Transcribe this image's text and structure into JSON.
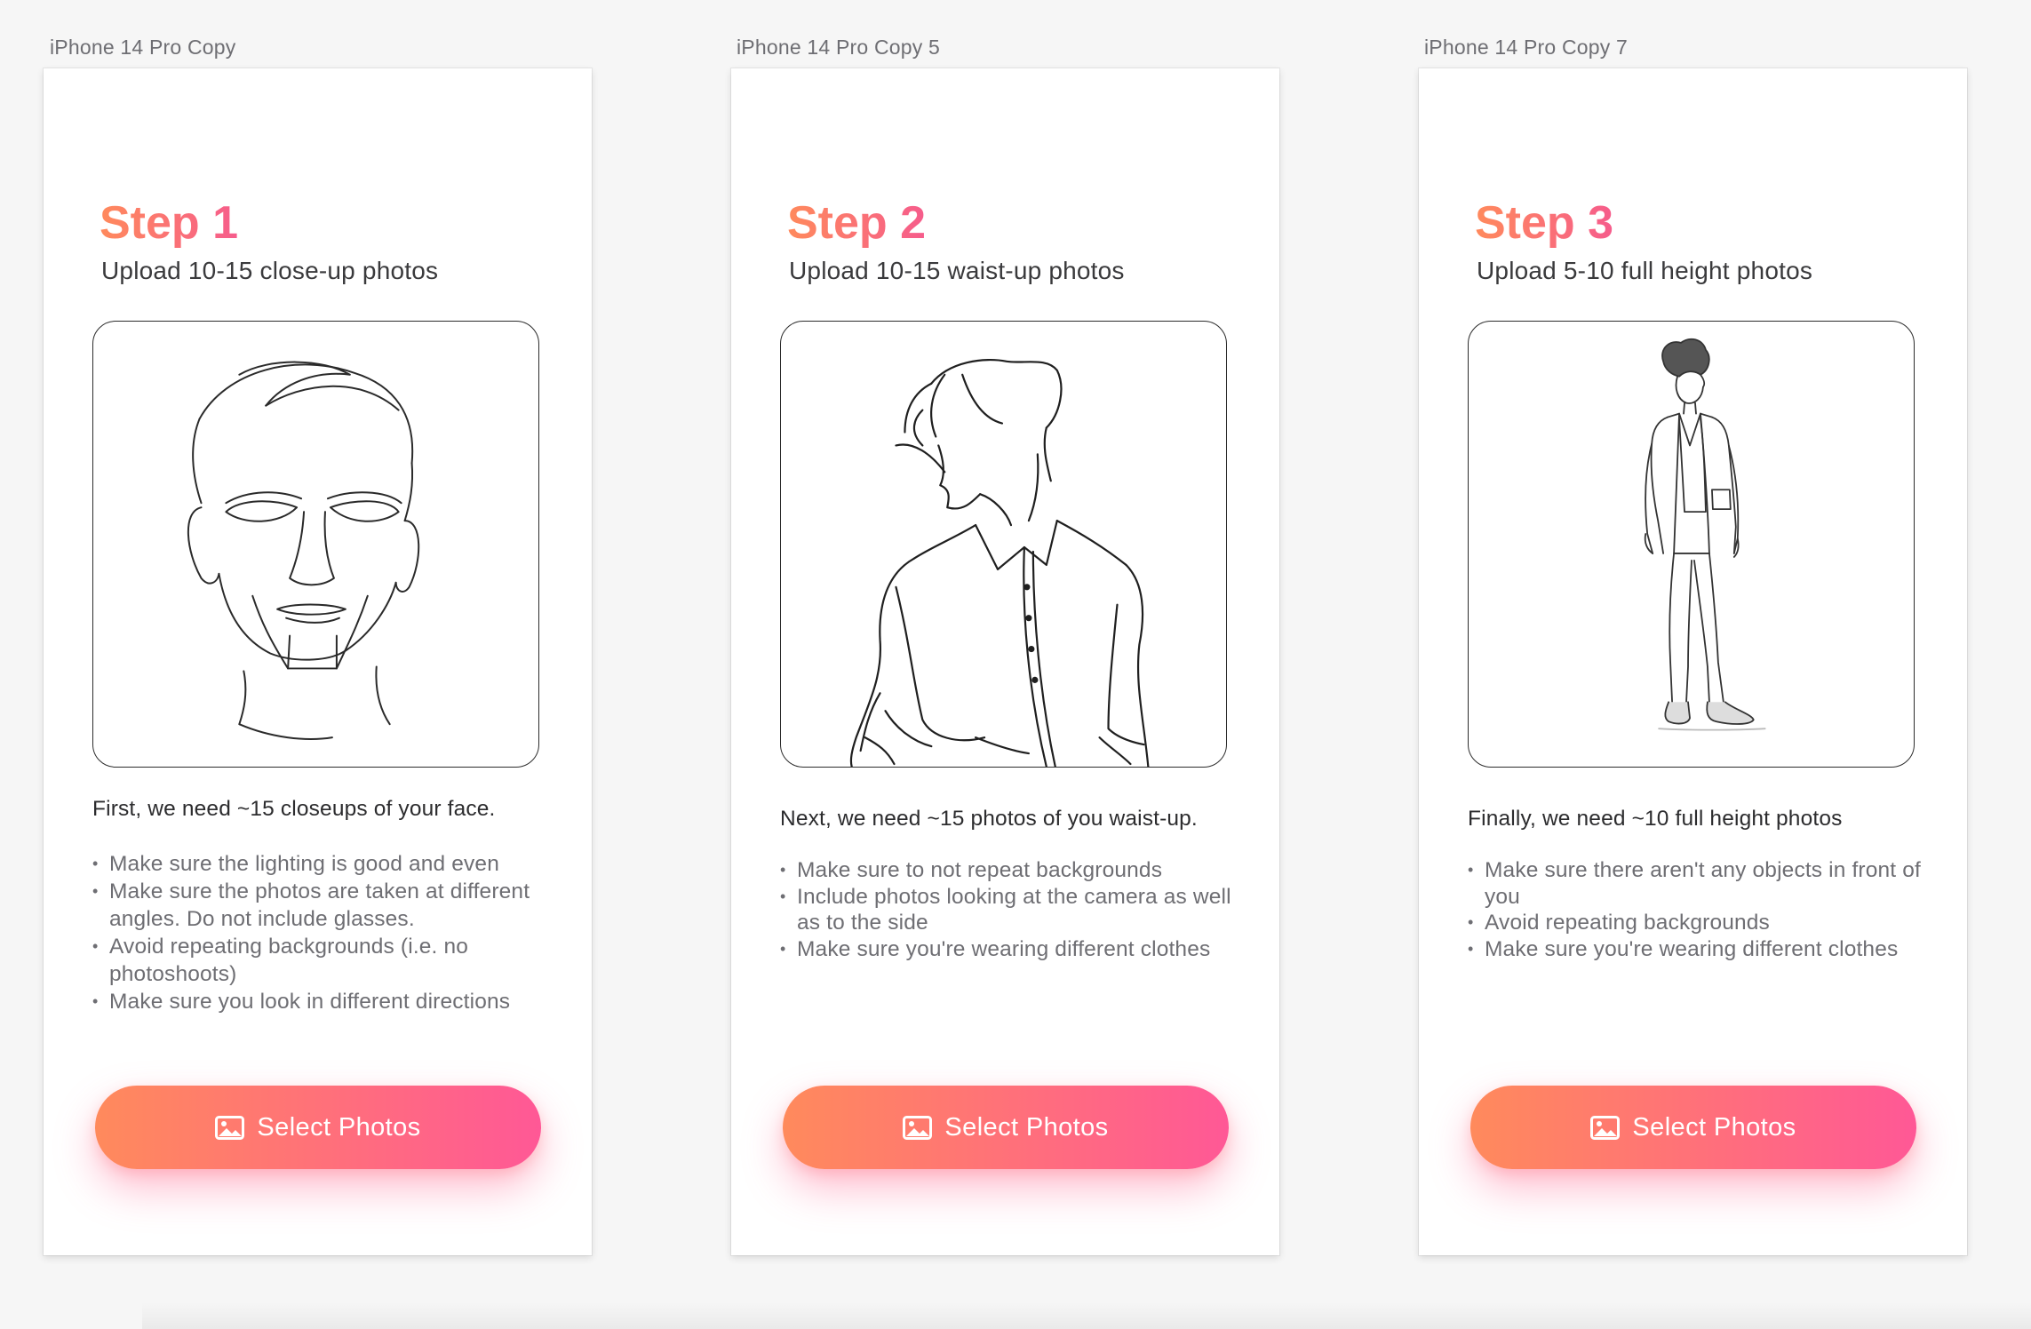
{
  "artboards": [
    {
      "label": "iPhone 14 Pro Copy",
      "step_title": "Step 1",
      "subtitle": "Upload 10-15 close-up photos",
      "illustration_icon": "face-closeup-line-art",
      "intro": "First, we need ~15 closeups of your face.",
      "tips": [
        "Make sure the lighting is good and even",
        "Make sure the photos are taken at different angles. Do not include glasses.",
        "Avoid repeating backgrounds (i.e. no photoshoots)",
        "Make sure you look in different directions"
      ],
      "button_label": "Select Photos",
      "button_icon": "image-icon"
    },
    {
      "label": "iPhone 14 Pro Copy 5",
      "step_title": "Step 2",
      "subtitle": "Upload 10-15 waist-up photos",
      "illustration_icon": "waist-up-line-art",
      "intro": "Next, we need ~15 photos of you waist-up.",
      "tips": [
        "Make sure to not repeat backgrounds",
        "Include photos looking at the camera as well as to the side",
        "Make sure you're wearing different clothes"
      ],
      "button_label": "Select Photos",
      "button_icon": "image-icon"
    },
    {
      "label": "iPhone 14 Pro Copy 7",
      "step_title": "Step 3",
      "subtitle": "Upload 5-10 full height photos",
      "illustration_icon": "full-height-sketch",
      "intro": "Finally, we need ~10 full height photos",
      "tips": [
        "Make sure there aren't any objects in front of you",
        "Avoid repeating backgrounds",
        "Make sure you're wearing different clothes"
      ],
      "button_label": "Select Photos",
      "button_icon": "image-icon"
    }
  ],
  "colors": {
    "gradient_start": "#ff8a5c",
    "gradient_end": "#ff5896",
    "canvas": "#f6f6f6",
    "card": "#ffffff"
  }
}
